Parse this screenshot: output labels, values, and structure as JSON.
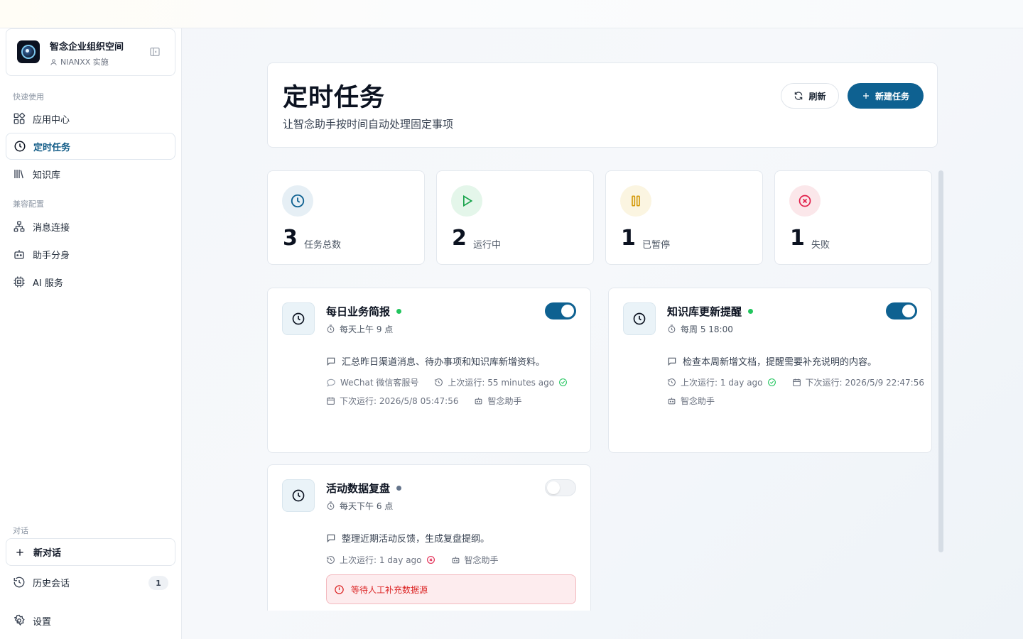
{
  "colors": {
    "accent": "#0e6191",
    "success": "#22c55e",
    "paused": "#d49a0b",
    "danger": "#e11d48",
    "inactive_dot": "#64748b"
  },
  "org": {
    "name": "智念企业组织空间",
    "subtitle": "NIANXX 实施"
  },
  "sidebar": {
    "section_quick": "快速使用",
    "section_compat": "兼容配置",
    "section_chat": "对话",
    "items": [
      {
        "label": "应用中心",
        "icon": "apps-icon"
      },
      {
        "label": "定时任务",
        "icon": "clock-icon",
        "active": true
      },
      {
        "label": "知识库",
        "icon": "library-icon"
      },
      {
        "label": "消息连接",
        "icon": "network-icon"
      },
      {
        "label": "助手分身",
        "icon": "bot-icon"
      },
      {
        "label": "AI 服务",
        "icon": "chip-icon"
      }
    ],
    "new_chat": "新对话",
    "history": "历史会话",
    "history_count": "1",
    "settings": "设置"
  },
  "header": {
    "title": "定时任务",
    "subtitle": "让智念助手按时间自动处理固定事项",
    "refresh_label": "刷新",
    "new_label": "新建任务"
  },
  "stats": [
    {
      "value": "3",
      "label": "任务总数",
      "icon": "clock-icon"
    },
    {
      "value": "2",
      "label": "运行中",
      "icon": "play-icon"
    },
    {
      "value": "1",
      "label": "已暂停",
      "icon": "pause-icon"
    },
    {
      "value": "1",
      "label": "失败",
      "icon": "x-circle-icon"
    }
  ],
  "tasks": [
    {
      "name": "每日业务简报",
      "enabled": true,
      "schedule": "每天上午 9 点",
      "description": "汇总昨日渠道消息、待办事项和知识库新增资料。",
      "channel": "WeChat  微信客服号",
      "last_run": "上次运行: 55 minutes ago",
      "next_run": "下次运行: 2026/5/8 05:47:56",
      "assistant": "智念助手"
    },
    {
      "name": "知识库更新提醒",
      "enabled": true,
      "schedule": "每周 5 18:00",
      "description": "检查本周新增文档，提醒需要补充说明的内容。",
      "last_run": "上次运行: 1 day ago",
      "next_run": "下次运行: 2026/5/9 22:47:56",
      "assistant": "智念助手"
    },
    {
      "name": "活动数据复盘",
      "enabled": false,
      "schedule": "每天下午 6 点",
      "description": "整理近期活动反馈，生成复盘提纲。",
      "last_run": "上次运行: 1 day ago",
      "assistant": "智念助手",
      "alert": "等待人工补充数据源"
    }
  ]
}
